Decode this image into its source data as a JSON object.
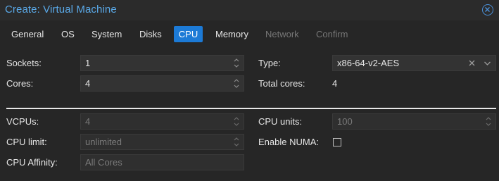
{
  "window": {
    "title": "Create: Virtual Machine",
    "accent_color": "#5aa9e8"
  },
  "tabs": [
    {
      "label": "General",
      "state": "normal"
    },
    {
      "label": "OS",
      "state": "normal"
    },
    {
      "label": "System",
      "state": "normal"
    },
    {
      "label": "Disks",
      "state": "normal"
    },
    {
      "label": "CPU",
      "state": "active"
    },
    {
      "label": "Memory",
      "state": "normal"
    },
    {
      "label": "Network",
      "state": "disabled"
    },
    {
      "label": "Confirm",
      "state": "disabled"
    }
  ],
  "cpu": {
    "sockets_label": "Sockets:",
    "sockets_value": "1",
    "cores_label": "Cores:",
    "cores_value": "4",
    "type_label": "Type:",
    "type_value": "x86-64-v2-AES",
    "total_cores_label": "Total cores:",
    "total_cores_value": "4",
    "vcpus_label": "VCPUs:",
    "vcpus_value": "4",
    "cpu_units_label": "CPU units:",
    "cpu_units_value": "100",
    "cpu_limit_label": "CPU limit:",
    "cpu_limit_value": "unlimited",
    "enable_numa_label": "Enable NUMA:",
    "enable_numa_checked": false,
    "cpu_affinity_label": "CPU Affinity:",
    "cpu_affinity_placeholder": "All Cores"
  },
  "icons": {
    "close": "close-circle-icon",
    "spinner": "up-down-spinner-icon",
    "clear": "clear-x-icon",
    "dropdown": "chevron-down-icon"
  }
}
